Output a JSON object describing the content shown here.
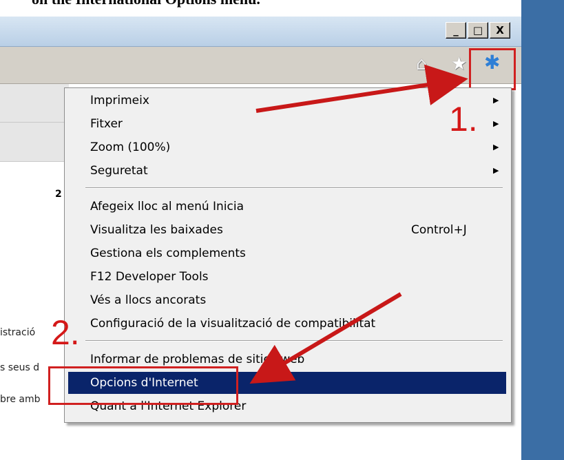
{
  "caption": "on the International Options menu.",
  "window": {
    "minimize_symbol": "_",
    "maximize_symbol": "□",
    "close_symbol": "X",
    "toolbar_icons": [
      "home-icon",
      "star-icon",
      "gear-icon"
    ]
  },
  "page_fragments": {
    "number": "2",
    "line_1": "istració",
    "line_2": "s seus d",
    "line_3": "bre amb"
  },
  "menu": {
    "items": [
      {
        "label": "Imprimeix",
        "submenu": true
      },
      {
        "label": "Fitxer",
        "submenu": true
      },
      {
        "label": "Zoom (100%)",
        "submenu": true
      },
      {
        "label": "Seguretat",
        "submenu": true
      },
      {
        "label": "Afegeix lloc al menú Inicia"
      },
      {
        "label": "Visualitza les baixades",
        "shortcut": "Control+J"
      },
      {
        "label": "Gestiona els complements"
      },
      {
        "label": "F12 Developer Tools"
      },
      {
        "label": "Vés a llocs ancorats"
      },
      {
        "label": "Configuració de la visualització de compatibilitat"
      },
      {
        "label": "Informar de problemas de sitios web"
      },
      {
        "label": "Opcions d'Internet",
        "selected": true
      },
      {
        "label": "Quant a l'Internet Explorer"
      }
    ]
  },
  "annotations": {
    "step1": "1.",
    "step2": "2.",
    "color": "#d41818"
  }
}
